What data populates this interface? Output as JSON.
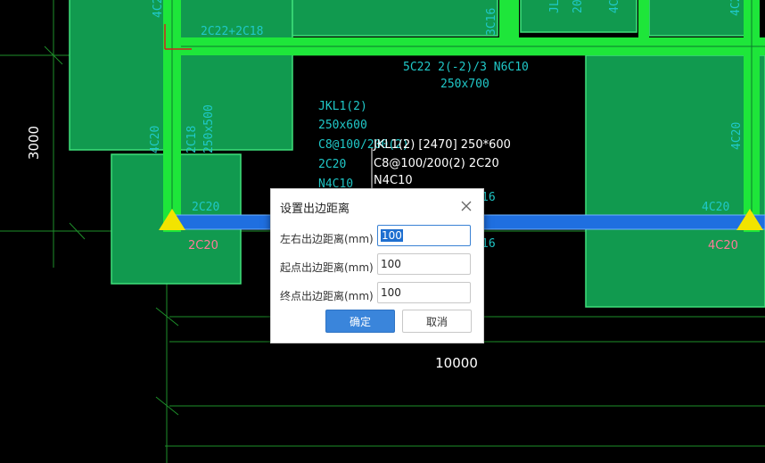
{
  "canvas": {
    "dimension_vertical": "3000",
    "dimension_horizontal": "10000",
    "labels": {
      "top_left_beam": "2C22+2C18",
      "top_col_left": "4C2",
      "top_col_mid": "3C16",
      "top_col_right_a": "JL",
      "top_col_right_b": "20",
      "top_col_right_c": "4C2",
      "top_col_far_right": "4C2",
      "beam_span_1": "5C22 2(-2)/3 N6C10",
      "beam_span_2": "250x700",
      "jkl_1": "JKL1(2)",
      "jkl_2": "250x600",
      "jkl_3": "C8@100/200(2)",
      "jkl_4": "2C20",
      "jkl_5": "N4C10",
      "col_left_a": "4C20",
      "col_left_b": "2C18",
      "col_left_c": "250x500",
      "left_support_top": "2C20",
      "left_support_bottom": "2C20",
      "right_col_mid": "4C20",
      "right_support_top": "4C20",
      "right_support_bottom": "4C20",
      "partial_16_a": "16",
      "partial_16_b": "16"
    },
    "annotation": {
      "line1": "JKL1(2) [2470] 250*600",
      "line2": "C8@100/200(2) 2C20",
      "line3": "N4C10"
    }
  },
  "dialog": {
    "title": "设置出边距离",
    "rows": [
      {
        "label": "左右出边距离(mm)",
        "value": "100"
      },
      {
        "label": "起点出边距离(mm)",
        "value": "100"
      },
      {
        "label": "终点出边距离(mm)",
        "value": "100"
      }
    ],
    "ok_label": "确定",
    "cancel_label": "取消"
  },
  "colors": {
    "background": "#000000",
    "slab_fill": "#119a4f",
    "beam_green": "#1ee63a",
    "beam_blue": "#1f6fe0",
    "support_yellow": "#f2e400",
    "cad_text_cyan": "#20c8c8",
    "support_label_pink": "#ff7a9a",
    "accent": "#3a85db"
  }
}
